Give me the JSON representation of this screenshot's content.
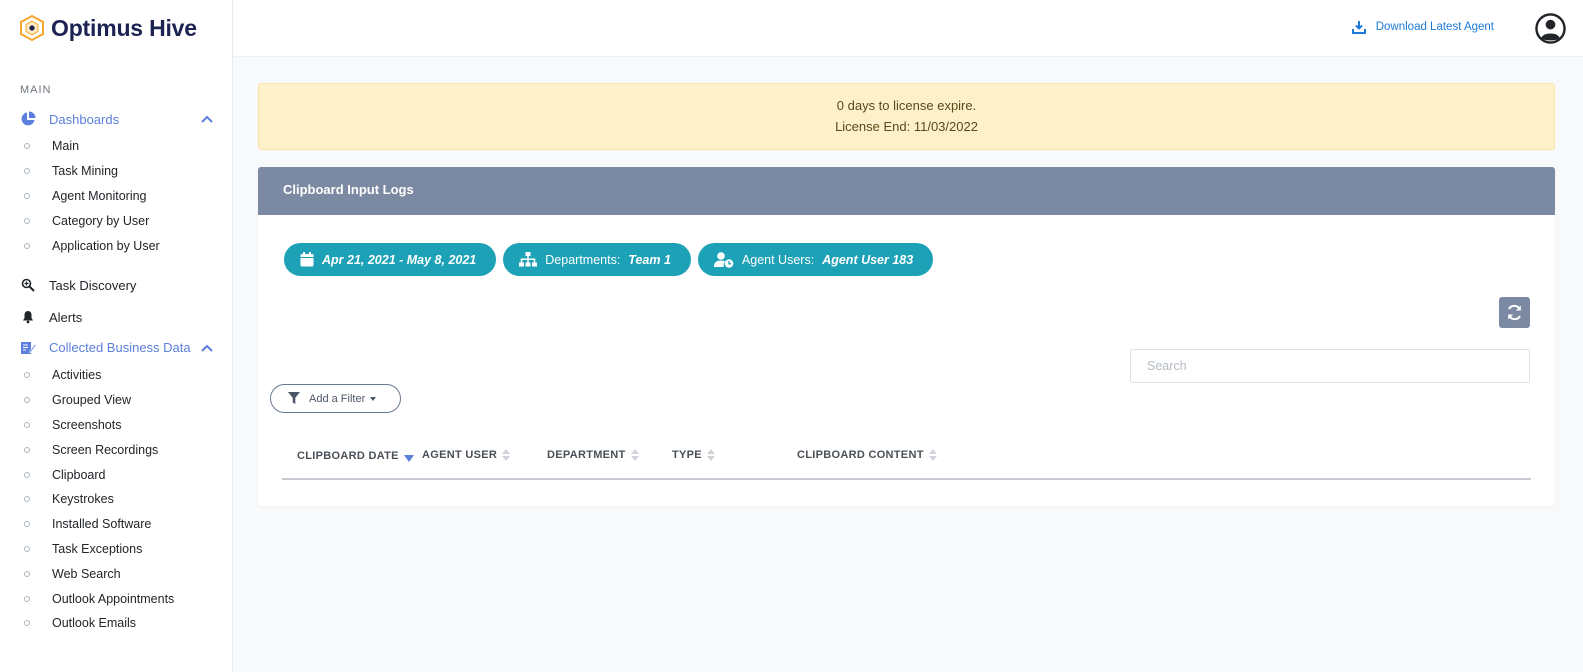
{
  "app": {
    "title": "Optimus Hive"
  },
  "sidebar": {
    "section_main": "MAIN",
    "dashboards": {
      "label": "Dashboards",
      "items": [
        "Main",
        "Task Mining",
        "Agent Monitoring",
        "Category by User",
        "Application by User"
      ]
    },
    "task_discovery": "Task Discovery",
    "alerts": "Alerts",
    "collected": {
      "label": "Collected Business Data",
      "items": [
        "Activities",
        "Grouped View",
        "Screenshots",
        "Screen Recordings",
        "Clipboard",
        "Keystrokes",
        "Installed Software",
        "Task Exceptions",
        "Web Search",
        "Outlook Appointments",
        "Outlook Emails"
      ]
    }
  },
  "topbar": {
    "download_label": "Download Latest Agent"
  },
  "license": {
    "line1": "0 days to license expire.",
    "line2": "License End: 11/03/2022"
  },
  "card": {
    "title": "Clipboard Input Logs",
    "date_range": "Apr 21, 2021 - May 8, 2021",
    "departments_label": "Departments:",
    "departments_value": "Team 1",
    "agents_label": "Agent Users:",
    "agents_value": "Agent User 183",
    "search_placeholder": "Search",
    "filter_label": "Add a Filter",
    "columns": [
      "CLIPBOARD DATE",
      "AGENT USER",
      "DEPARTMENT",
      "TYPE",
      "CLIPBOARD CONTENT"
    ]
  },
  "colors": {
    "accent": "#5b7fdb",
    "pill": "#1da1b7",
    "header": "#7b8aa2",
    "alert_bg": "#fdf1cc",
    "brand": "#1c2353"
  }
}
